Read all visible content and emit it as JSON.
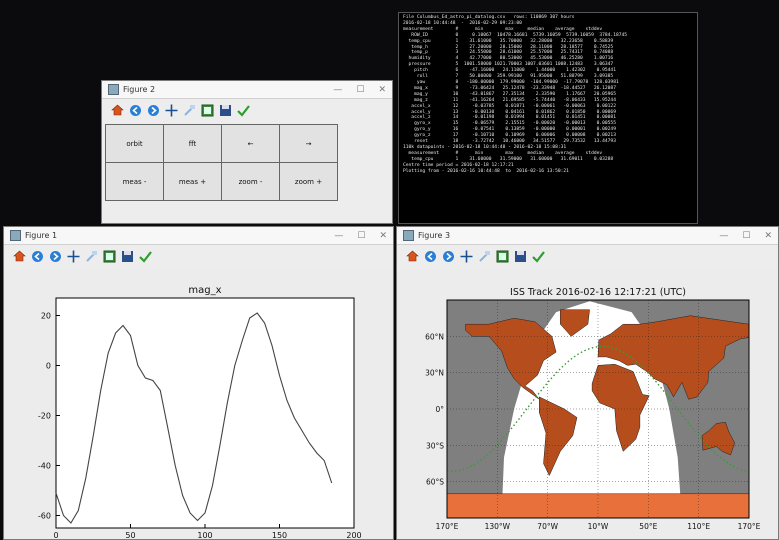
{
  "colors": {
    "border_accent": "#c2185b",
    "desktop": "#0b0b0d",
    "ocean": "#7f7f7f",
    "land": "#b54d1c",
    "day": "#ffffff",
    "antarctica": "#e8703a",
    "track": "#3a9a3a"
  },
  "control_window": {
    "title": "Figure 2",
    "toolbar_icons": [
      "home-icon",
      "back-icon",
      "forward-icon",
      "pan-icon",
      "zoom-icon",
      "subplots-icon",
      "save-icon",
      "edit-icon"
    ],
    "buttons": [
      {
        "name": "orbit-button",
        "label": "orbit"
      },
      {
        "name": "fft-button",
        "label": "fft"
      },
      {
        "name": "left-button",
        "label": "←"
      },
      {
        "name": "right-button",
        "label": "→"
      },
      {
        "name": "meas-minus-button",
        "label": "meas -"
      },
      {
        "name": "meas-plus-button",
        "label": "meas +"
      },
      {
        "name": "zoom-minus-button",
        "label": "zoom -"
      },
      {
        "name": "zoom-plus-button",
        "label": "zoom +"
      }
    ]
  },
  "terminal": {
    "lines": [
      "File Columbus_Ed_astro_pi_datalog.csv   rows: 110869 307 hours",
      "2016-02-18 10:44:48  -  2016-02-29 09:23:00",
      "measurement        #      min        max     median    average    stddev",
      "   ROW_ID          0     0.10067  10478.16681  5739.16059  5739.16059  3784.18745",
      "  temp_cpu         1    31.61000   35.70000   32.28000   32.23658    0.58839",
      "   temp_h          2    27.20000   28.15000   28.11000   28.18577    0.74525",
      "   temp_p          3    24.55000   28.61000   25.57000   25.74317    0.74088",
      "  humidity         4    42.77000   80.53000   45.53000   46.25280    1.00716",
      "  pressure         5  1001.58000 1021.70003 1007.03601 1008.12483    3.06347",
      "    pitch          6    -47.16000   24.11000    1.44000    1.42302    0.95441",
      "     roll          7    50.00000  359.99100   91.95000   51.88799    3.09385",
      "     yaw           8   -180.00000  179.99000  -104.99000  -17.79078  128.03981",
      "    mag_x          9    -73.06424   25.12478  -23.33948  -18.44527   26.12087",
      "    mag_y         10    -43.01867   27.35134    2.33590    1.17667   20.05965",
      "    mag_z         11    -41.16264   21.69585   -5.74440   -8.06433   15.95244",
      "   accel_x        12     -0.03785    0.01871   -0.00061   -0.00063    0.00122",
      "   accel_y        13     -0.00130    0.04161    0.01862    0.01850    0.00069",
      "   accel_z        14     -0.01198    0.01994    0.01451    0.01451    0.00081",
      "    gyro_x        15     -0.06579    2.15515   -0.00020   -0.00013    0.00555",
      "    gyro_y        16     -0.07541    0.13859   -0.00000    0.00001    0.00249",
      "    gyro_z        17     -0.10710    0.10969    0.00006    0.00008    0.00213",
      "    reset         18     -3.72742   10.46000   34.51577   29.73532   13.44793",
      "110k datapoints - 2016-02-18 10:44:48 - 2016-02-18 15:08:31",
      "  measurement      #      min        max     median    average    stddev",
      "   temp_cpu        1    31.60000   31.59000   31.60000   31.69011    0.03288",
      "Centre time period = 2016-02-18 12:17:21",
      "Plotting from - 2016-02-16 10:44:48  to  2016-02-16 13:50:21"
    ]
  },
  "magx_window": {
    "title": "Figure 1",
    "toolbar_icons": [
      "home-icon",
      "back-icon",
      "forward-icon",
      "pan-icon",
      "zoom-icon",
      "subplots-icon",
      "save-icon",
      "edit-icon"
    ]
  },
  "map_window": {
    "title": "Figure 3",
    "toolbar_icons": [
      "home-icon",
      "back-icon",
      "forward-icon",
      "pan-icon",
      "zoom-icon",
      "subplots-icon",
      "save-icon",
      "edit-icon"
    ]
  },
  "chart_data": [
    {
      "type": "line",
      "title": "mag_x",
      "xlabel": "",
      "ylabel": "",
      "xlim": [
        0,
        200
      ],
      "ylim": [
        -65,
        27
      ],
      "xticks": [
        "0",
        "50",
        "100",
        "150",
        "200"
      ],
      "yticks": [
        "20",
        "0",
        "-20",
        "-40",
        "-60"
      ],
      "ytick_values": [
        20,
        0,
        -20,
        -40,
        -60
      ],
      "xtick_values": [
        0,
        50,
        100,
        150,
        200
      ],
      "series": [
        {
          "x": [
            0,
            5,
            10,
            15,
            20,
            25,
            30,
            35,
            40,
            45,
            50,
            55,
            60,
            65,
            70,
            75,
            80,
            85,
            90,
            95,
            100,
            105,
            110,
            115,
            120,
            125,
            130,
            135,
            140,
            145,
            150,
            155,
            160,
            165,
            170,
            175,
            180,
            185
          ],
          "y": [
            -51,
            -60,
            -63,
            -58,
            -45,
            -28,
            -10,
            5,
            13,
            16,
            12,
            0,
            -5,
            -6,
            -10,
            -25,
            -40,
            -52,
            -59,
            -62,
            -59,
            -48,
            -32,
            -15,
            0,
            10,
            19,
            21,
            17,
            8,
            -4,
            -14,
            -21,
            -26,
            -31,
            -35,
            -38,
            -47
          ]
        }
      ]
    },
    {
      "type": "map",
      "title": "ISS Track 2016-02-16 12:17:21 (UTC)",
      "lat_labels": [
        "60°N",
        "30°N",
        "0°",
        "30°S",
        "60°S"
      ],
      "lat_values": [
        60,
        30,
        0,
        -30,
        -60
      ],
      "lon_labels": [
        "170°E",
        "130°W",
        "70°W",
        "10°W",
        "50°E",
        "110°E",
        "170°E"
      ],
      "lon_values": [
        -190,
        -130,
        -70,
        -10,
        50,
        110,
        170
      ]
    }
  ]
}
